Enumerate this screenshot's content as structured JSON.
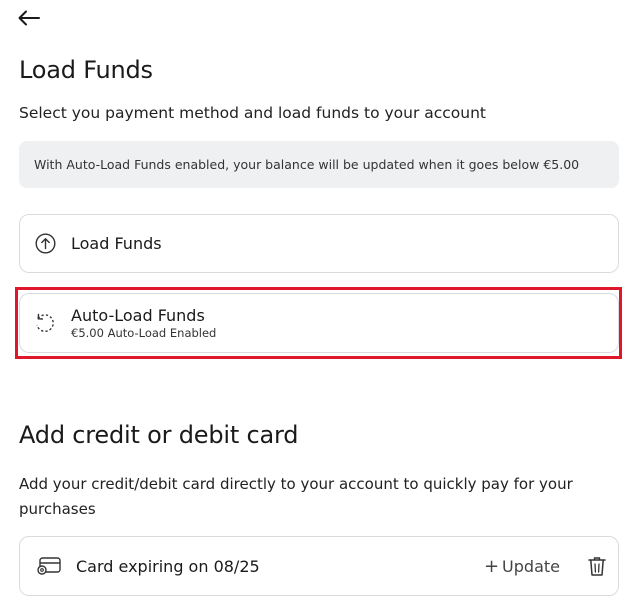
{
  "header": {
    "back_icon": "arrow-left-icon"
  },
  "load_funds": {
    "title": "Load Funds",
    "subtitle": "Select you payment method and load funds to your account",
    "info_text": "With Auto-Load Funds enabled, your balance will be updated when it goes below €5.00",
    "options": [
      {
        "label": "Load Funds",
        "icon": "arrow-up-circle-icon"
      },
      {
        "label": "Auto-Load Funds",
        "sublabel": "€5.00 Auto-Load Enabled",
        "icon": "refresh-dashed-icon"
      }
    ]
  },
  "highlight_color": "#e0162b",
  "card_section": {
    "title": "Add credit or debit card",
    "description": "Add your credit/debit card directly to your account to quickly pay for your purchases",
    "card": {
      "label": "Card expiring on 08/25",
      "icon": "credit-card-icon",
      "update_label": "Update",
      "update_prefix": "+",
      "delete_icon": "trash-icon"
    }
  }
}
